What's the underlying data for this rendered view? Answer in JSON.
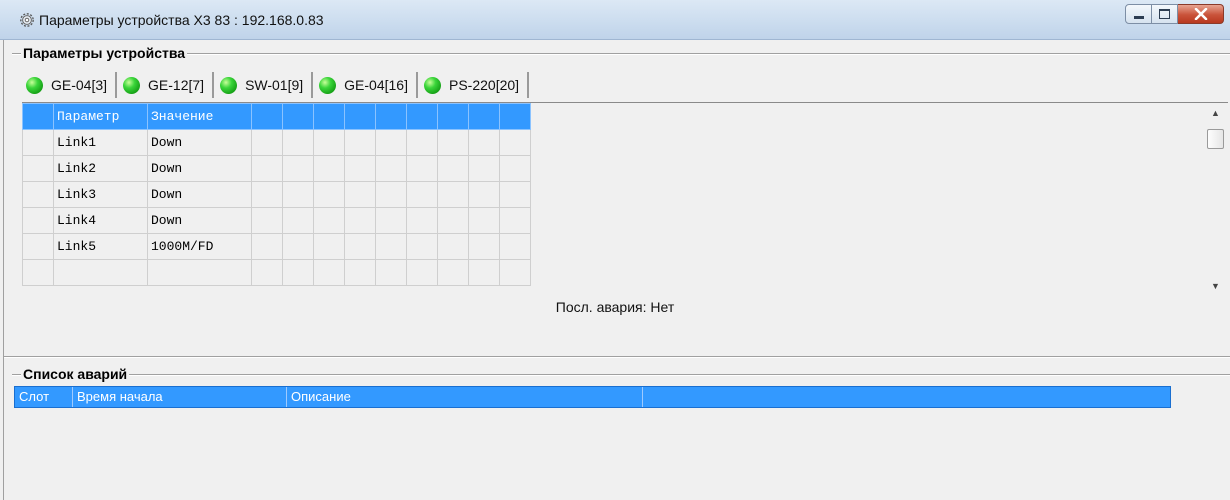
{
  "window": {
    "title": "Параметры устройства X3 83 : 192.168.0.83"
  },
  "device_params": {
    "label": "Параметры устройства",
    "tabs": [
      {
        "label": "GE-04[3]",
        "status_color": "#22c022"
      },
      {
        "label": "GE-12[7]",
        "status_color": "#22c022"
      },
      {
        "label": "SW-01[9]",
        "status_color": "#22c022"
      },
      {
        "label": "GE-04[16]",
        "status_color": "#22c022"
      },
      {
        "label": "PS-220[20]",
        "status_color": "#22c022"
      }
    ],
    "grid": {
      "columns": [
        "Параметр",
        "Значение"
      ],
      "rows": [
        [
          "Link1",
          "Down"
        ],
        [
          "Link2",
          "Down"
        ],
        [
          "Link3",
          "Down"
        ],
        [
          "Link4",
          "Down"
        ],
        [
          "Link5",
          "1000M/FD"
        ]
      ]
    },
    "last_alarm": "Посл. авария: Нет"
  },
  "alarm_list": {
    "label": "Список аварий",
    "columns": [
      "Слот",
      "Время начала",
      "Описание"
    ]
  },
  "colors": {
    "accent": "#3399ff"
  }
}
